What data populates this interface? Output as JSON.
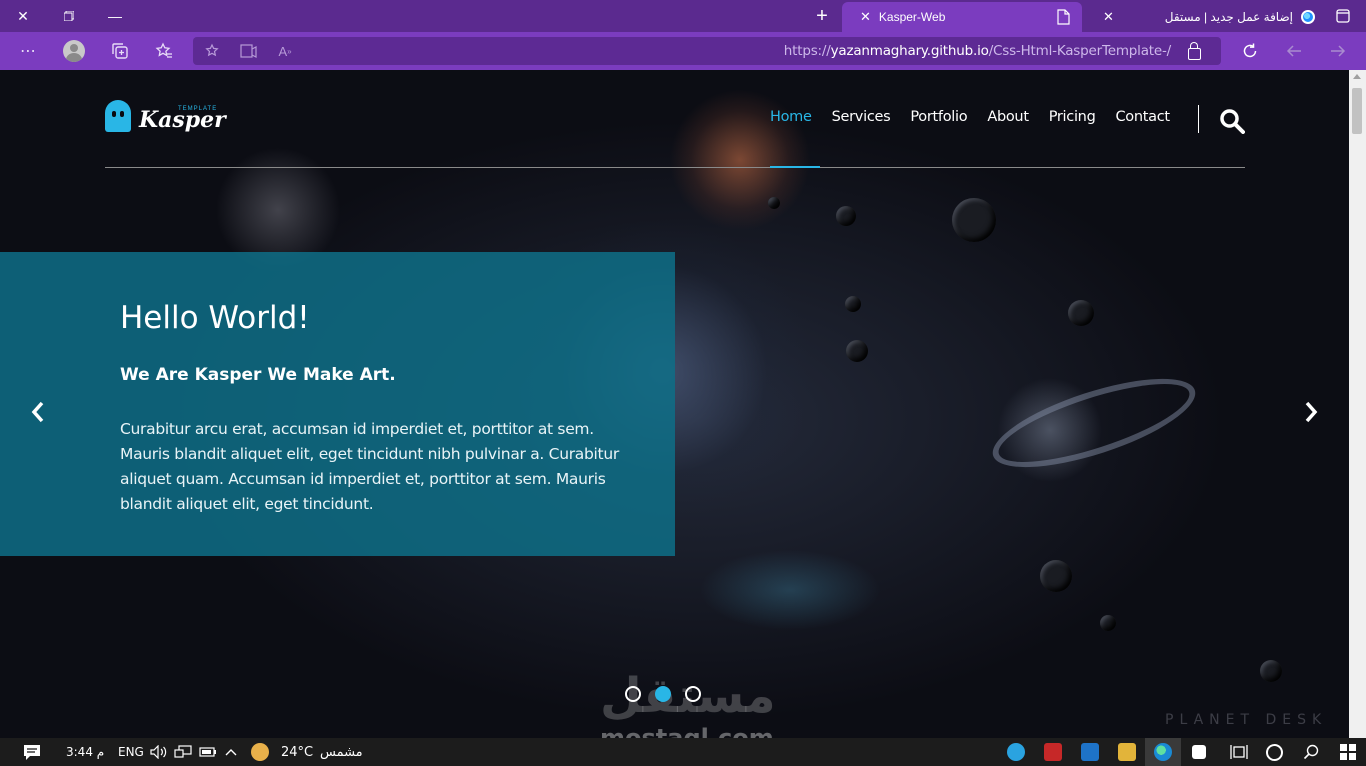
{
  "browser": {
    "tabs": [
      {
        "title": "Kasper-Web",
        "active": true
      },
      {
        "title": "إضافة عمل جديد | مستقل",
        "active": false
      }
    ],
    "new_tab_label": "+",
    "url_prefix": "https://",
    "url_host": "yazanmaghary.github.io",
    "url_path": "/Css-Html-KasperTemplate-/"
  },
  "site": {
    "logo_text": "Kasper",
    "logo_tag": "TEMPLATE",
    "nav": [
      {
        "label": "Home",
        "active": true
      },
      {
        "label": "Services",
        "active": false
      },
      {
        "label": "Portfolio",
        "active": false
      },
      {
        "label": "About",
        "active": false
      },
      {
        "label": "Pricing",
        "active": false
      },
      {
        "label": "Contact",
        "active": false
      }
    ],
    "hero": {
      "title": "Hello World!",
      "subtitle": "We Are Kasper We Make Art.",
      "text": "Curabitur arcu erat, accumsan id imperdiet et, porttitor at sem. Mauris blandit aliquet elit, eget tincidunt nibh pulvinar a. Curabitur aliquet quam. Accumsan id imperdiet et, porttitor at sem. Mauris blandit aliquet elit, eget tincidunt."
    },
    "slider_dots": 3,
    "slider_active_index": 1,
    "accent_color": "#29b6e6"
  },
  "watermark": {
    "arabic": "مستقل",
    "latin": "mostaql.com",
    "planet": "PLANET DESK"
  },
  "taskbar": {
    "time": "3:44 م",
    "lang": "ENG",
    "temperature": "24°C",
    "weather": "مشمس"
  }
}
